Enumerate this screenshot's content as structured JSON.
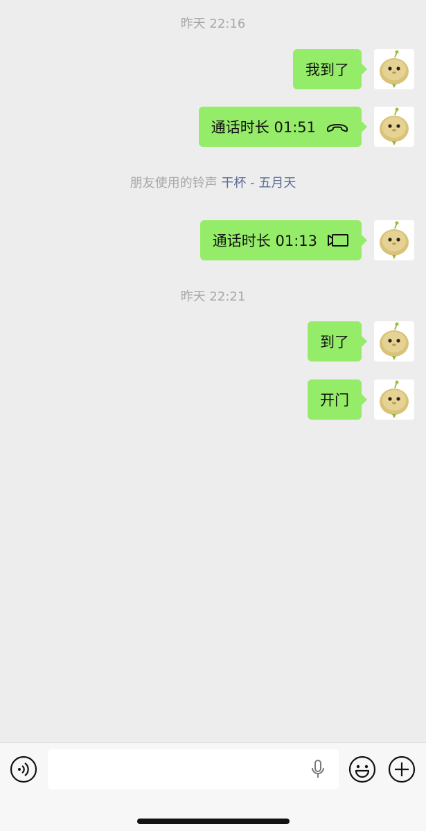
{
  "colors": {
    "background": "#ededed",
    "bubble_self": "#95ec69",
    "link": "#576b95",
    "timestamp": "#a8a8a8"
  },
  "messages": {
    "timestamp_1": "昨天 22:16",
    "msg_1": "我到了",
    "msg_2": "通话时长 01:51",
    "msg_2_icon": "phone-hangup-icon",
    "ringtone_prefix": "朋友使用的铃声",
    "ringtone_song": "干杯 - 五月天",
    "msg_3": "通话时长 01:13",
    "msg_3_icon": "video-call-icon",
    "timestamp_2": "昨天 22:21",
    "msg_4": "到了",
    "msg_5": "开门"
  },
  "input_bar": {
    "voice_icon": "voice-mode-icon",
    "mic_icon": "microphone-icon",
    "emoji_icon": "emoji-icon",
    "plus_icon": "plus-icon"
  }
}
